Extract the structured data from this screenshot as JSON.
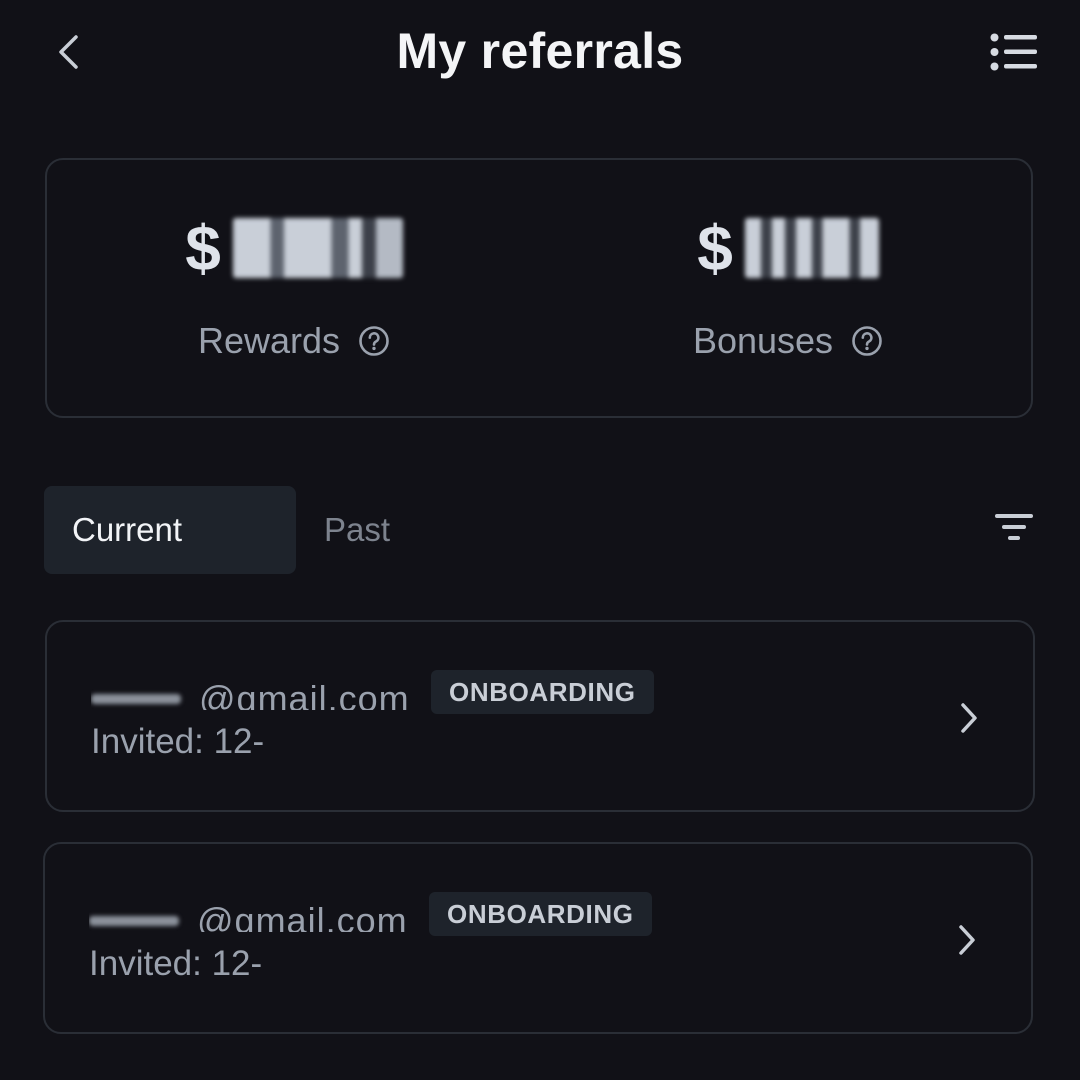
{
  "header": {
    "title": "My referrals",
    "back_icon": "chevron-left-icon",
    "menu_icon": "list-icon"
  },
  "summary": {
    "rewards": {
      "currency": "$",
      "amount": "",
      "label": "Rewards",
      "help_icon": "question-circle-icon"
    },
    "bonuses": {
      "currency": "$",
      "amount": "",
      "label": "Bonuses",
      "help_icon": "question-circle-icon"
    }
  },
  "tabs": [
    {
      "label": "Current",
      "active": true
    },
    {
      "label": "Past",
      "active": false
    }
  ],
  "filter_icon": "filter-icon",
  "referrals": [
    {
      "email_visible": "@gmail.com",
      "status": "ONBOARDING",
      "invited": "Invited: 12-"
    },
    {
      "email_visible": "@gmail.com",
      "status": "ONBOARDING",
      "invited": "Invited: 12-"
    }
  ],
  "colors": {
    "background": "#111117",
    "card_border": "#2a2e36",
    "badge_bg": "#1e232b",
    "muted_text": "#9aa1ad",
    "primary_text": "#f2f3f5"
  }
}
